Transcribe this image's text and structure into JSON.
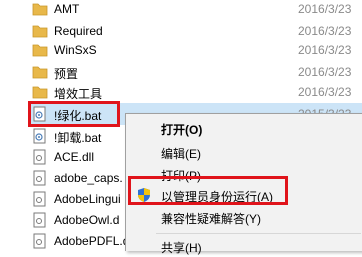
{
  "files": [
    {
      "name": "AMT",
      "date": "2016/3/23",
      "type": "folder"
    },
    {
      "name": "Required",
      "date": "2016/3/23",
      "type": "folder"
    },
    {
      "name": "WinSxS",
      "date": "2016/3/23",
      "type": "folder"
    },
    {
      "name": "预置",
      "date": "2016/3/23",
      "type": "folder"
    },
    {
      "name": "增效工具",
      "date": "2016/3/23",
      "type": "folder"
    },
    {
      "name": "!绿化.bat",
      "date": "2015/3/23",
      "type": "bat"
    },
    {
      "name": "!卸载.bat",
      "date": "",
      "type": "bat"
    },
    {
      "name": "ACE.dll",
      "date": "",
      "type": "dll"
    },
    {
      "name": "adobe_caps.",
      "date": "",
      "type": "dll"
    },
    {
      "name": "AdobeLingui",
      "date": "",
      "type": "dll"
    },
    {
      "name": "AdobeOwl.d",
      "date": "",
      "type": "dll"
    },
    {
      "name": "AdobePDFL.d",
      "date": "",
      "type": "dll"
    }
  ],
  "context_menu": {
    "items": [
      {
        "label": "打开(O)",
        "bold": true
      },
      {
        "label": "编辑(E)"
      },
      {
        "label": "打印(P)"
      },
      {
        "label": "以管理员身份运行(A)",
        "icon": "uac-shield-icon"
      },
      {
        "label": "兼容性疑难解答(Y)"
      },
      {
        "label": "共享(H)"
      }
    ]
  },
  "colors": {
    "highlight": "#e0141b",
    "selection": "#cce4f7",
    "folder": "#e8b84a"
  }
}
